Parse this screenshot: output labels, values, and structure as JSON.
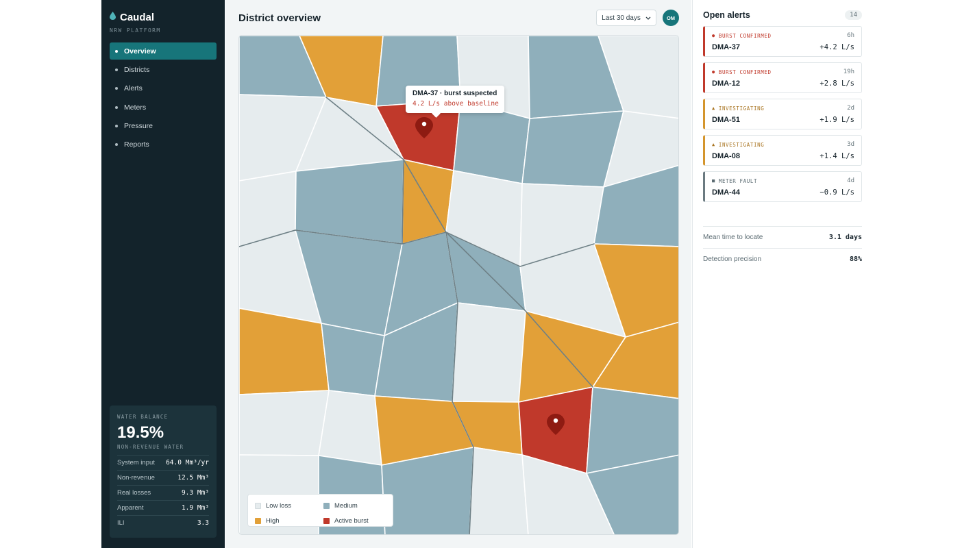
{
  "app": {
    "name": "Caudal",
    "subtitle": "NRW PLATFORM"
  },
  "sidebar": {
    "items": [
      {
        "label": "Overview",
        "active": true
      },
      {
        "label": "Districts"
      },
      {
        "label": "Alerts"
      },
      {
        "label": "Meters"
      },
      {
        "label": "Pressure"
      },
      {
        "label": "Reports"
      }
    ]
  },
  "water_balance": {
    "label": "WATER BALANCE",
    "value": "19.5%",
    "sub": "NON-REVENUE WATER",
    "rows": [
      {
        "k": "System input",
        "v": "64.0 Mm³/yr"
      },
      {
        "k": "Non-revenue",
        "v": "12.5 Mm³"
      },
      {
        "k": "Real losses",
        "v": "9.3 Mm³"
      },
      {
        "k": "Apparent",
        "v": "1.9 Mm³"
      },
      {
        "k": "ILI",
        "v": "3.3"
      }
    ]
  },
  "header": {
    "title": "District overview",
    "range": "Last 30 days",
    "avatar": "OM"
  },
  "map": {
    "tooltip": {
      "title": "DMA-37 · burst suspected",
      "sub": "4.2 L/s above baseline"
    },
    "legend": [
      {
        "label": "Low loss",
        "color": "#e6ecee"
      },
      {
        "label": "Medium",
        "color": "#8fafbb"
      },
      {
        "label": "High",
        "color": "#e2a038"
      },
      {
        "label": "Active burst",
        "color": "#c0392b"
      }
    ]
  },
  "alerts": {
    "title": "Open alerts",
    "count": "14",
    "items": [
      {
        "status": "BURST CONFIRMED",
        "icon": "●",
        "age": "6h",
        "dma": "DMA-37",
        "flow": "+4.2 L/s",
        "color": "#c0392b"
      },
      {
        "status": "BURST CONFIRMED",
        "icon": "●",
        "age": "19h",
        "dma": "DMA-12",
        "flow": "+2.8 L/s",
        "color": "#c0392b"
      },
      {
        "status": "INVESTIGATING",
        "icon": "▲",
        "age": "2d",
        "dma": "DMA-51",
        "flow": "+1.9 L/s",
        "color": "#d4952d"
      },
      {
        "status": "INVESTIGATING",
        "icon": "▲",
        "age": "3d",
        "dma": "DMA-08",
        "flow": "+1.4 L/s",
        "color": "#d4952d"
      },
      {
        "status": "METER FAULT",
        "icon": "■",
        "age": "4d",
        "dma": "DMA-44",
        "flow": "−0.9 L/s",
        "color": "#6b7a80"
      }
    ]
  },
  "metrics": [
    {
      "k": "Mean time to locate",
      "v": "3.1 days"
    },
    {
      "k": "Detection precision",
      "v": "88%"
    }
  ]
}
